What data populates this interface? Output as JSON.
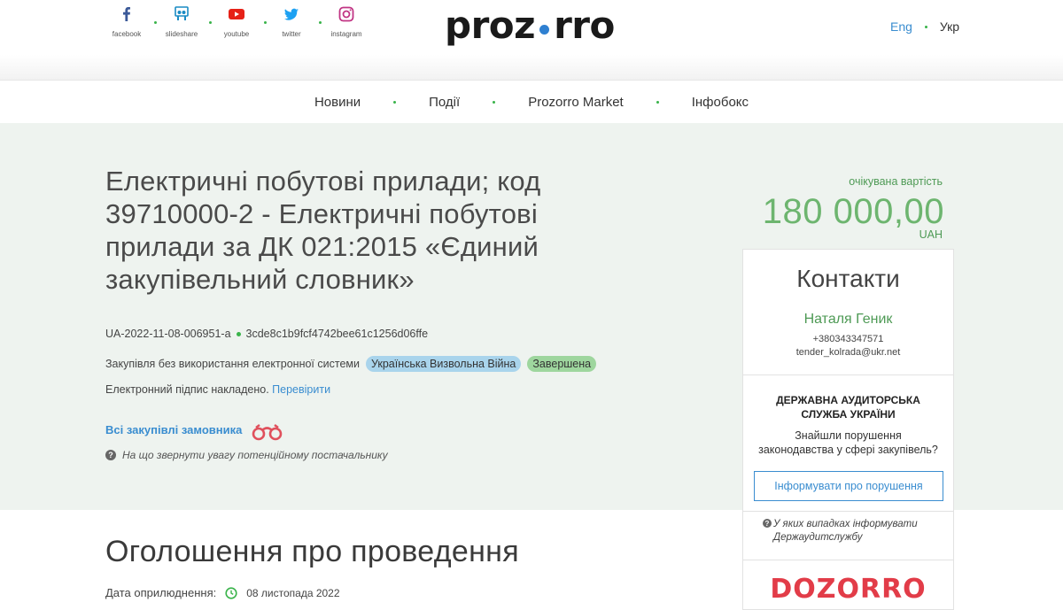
{
  "header": {
    "social": [
      {
        "label": "facebook",
        "icon": "facebook-icon",
        "color": "#3b5998"
      },
      {
        "label": "slideshare",
        "icon": "slideshare-icon",
        "color": "#1a8bc4"
      },
      {
        "label": "youtube",
        "icon": "youtube-icon",
        "color": "#e62117"
      },
      {
        "label": "twitter",
        "icon": "twitter-icon",
        "color": "#1da1f2"
      },
      {
        "label": "instagram",
        "icon": "instagram-icon",
        "color": "#c13584"
      }
    ],
    "logo_left": "proz",
    "logo_right": "rro",
    "lang_en": "Eng",
    "lang_ua": "Укр"
  },
  "nav": {
    "items": [
      "Новини",
      "Події",
      "Prozorro Market",
      "Інфобокс"
    ]
  },
  "tender": {
    "title": "Електричні побутові прилади; код 39710000-2 - Електричні побутові прилади за ДК 021:2015 «Єдиний закупівельний словник»",
    "id": "UA-2022-11-08-006951-a",
    "hash": "3cde8c1b9fcf4742bee61c1256d06ffe",
    "method": "Закупівля без використання електронної системи",
    "badge_war": "Українська Визвольна Війна",
    "badge_status": "Завершена",
    "signature_text": "Електронний підпис накладено.",
    "signature_link": "Перевірити",
    "all_purchases_link": "Всі закупівлі замовника",
    "hint": "На що звернути увагу потенційному постачальнику"
  },
  "price": {
    "label": "очікувана вартість",
    "value": "180 000,00",
    "currency": "UAH"
  },
  "contacts": {
    "title": "Контакти",
    "name": "Наталя Геник",
    "phone": "+380343347571",
    "email": "tender_kolrada@ukr.net",
    "audit_title_line1": "ДЕРЖАВНА АУДИТОРСЬКА",
    "audit_title_line2": "СЛУЖБА УКРАЇНИ",
    "audit_text_line1": "Знайшли порушення",
    "audit_text_line2": "законодавства у сфері закупівель?",
    "report_button": "Інформувати про порушення",
    "audit_hint_line1": "У яких випадках інформувати",
    "audit_hint_line2": "Держаудитслужбу",
    "dozorro_logo": "DOZORRO"
  },
  "announcement": {
    "title": "Оголошення про проведення",
    "pub_label": "Дата оприлюднення:",
    "pub_date": "08 листопада 2022"
  },
  "colors": {
    "accent_blue": "#3a8dd0",
    "accent_green": "#39b34a",
    "price_green": "#6db56f",
    "hero_bg": "#eef3ef",
    "dozorro_red": "#e23c48"
  }
}
